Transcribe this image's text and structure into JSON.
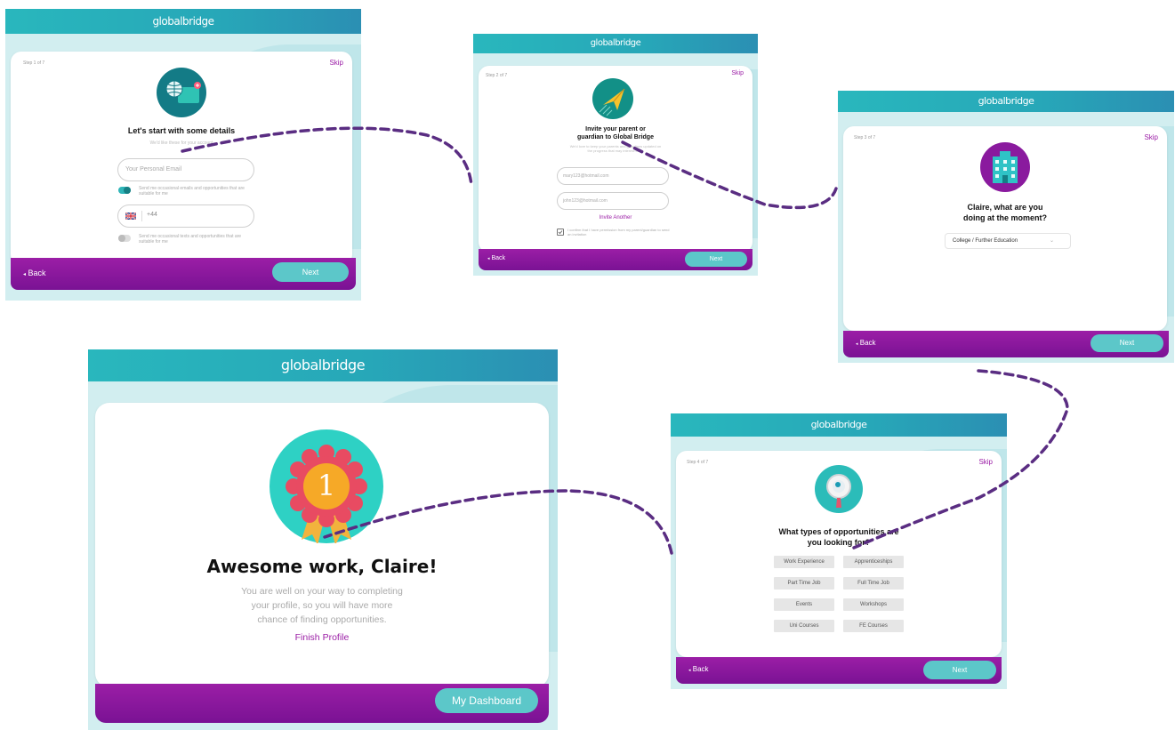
{
  "brand": "globalbridge",
  "screen1": {
    "step": "Step 1 of 7",
    "skip": "Skip",
    "title": "Let's start with some details",
    "subtitle": "We'd like these for your account",
    "email_placeholder": "Your Personal Email",
    "toggle1_text": "Send me occasional emails and opportunities that are suitable for me",
    "phone_prefix": "+44",
    "toggle2_text": "Send me occasional texts and opportunities that are suitable for me",
    "back": "Back",
    "next": "Next"
  },
  "screen2": {
    "step": "Step 2 of 7",
    "skip": "Skip",
    "title_line1": "Invite your parent or",
    "title_line2": "guardian to Global Bridge",
    "subtitle": "We'd love to keep your parents and guardians updated on the progress that may interest them",
    "email1": "mary123@hotmail.com",
    "email2": "john123@hotmail.com",
    "invite_another": "Invite Another",
    "confirm_text": "I confirm that I have permission from my parent/guardian to send an invitation",
    "back": "Back",
    "next": "Next"
  },
  "screen3": {
    "step": "Step 3 of 7",
    "skip": "Skip",
    "title_line1": "Claire, what are you",
    "title_line2": "doing at the moment?",
    "select_value": "College / Further Education",
    "back": "Back",
    "next": "Next"
  },
  "screen4": {
    "step": "Step 4 of 7",
    "skip": "Skip",
    "title_line1": "What types of opportunities are",
    "title_line2": "you looking for?",
    "options": [
      "Work Experience",
      "Apprenticeships",
      "Part Time Job",
      "Full Time Job",
      "Events",
      "Workshops",
      "Uni Courses",
      "FE Courses"
    ],
    "back": "Back",
    "next": "Next"
  },
  "screen5": {
    "badge_number": "1",
    "title": "Awesome work, Claire!",
    "body_line1": "You are well on your way to completing",
    "body_line2": "your profile, so you will have more",
    "body_line3": "chance of finding opportunities.",
    "finish": "Finish Profile",
    "dashboard": "My Dashboard"
  },
  "colors": {
    "teal": "#29b7bd",
    "purple": "#8a1a9e",
    "button_teal": "#5cc7c9",
    "dash": "#5a2d82"
  }
}
